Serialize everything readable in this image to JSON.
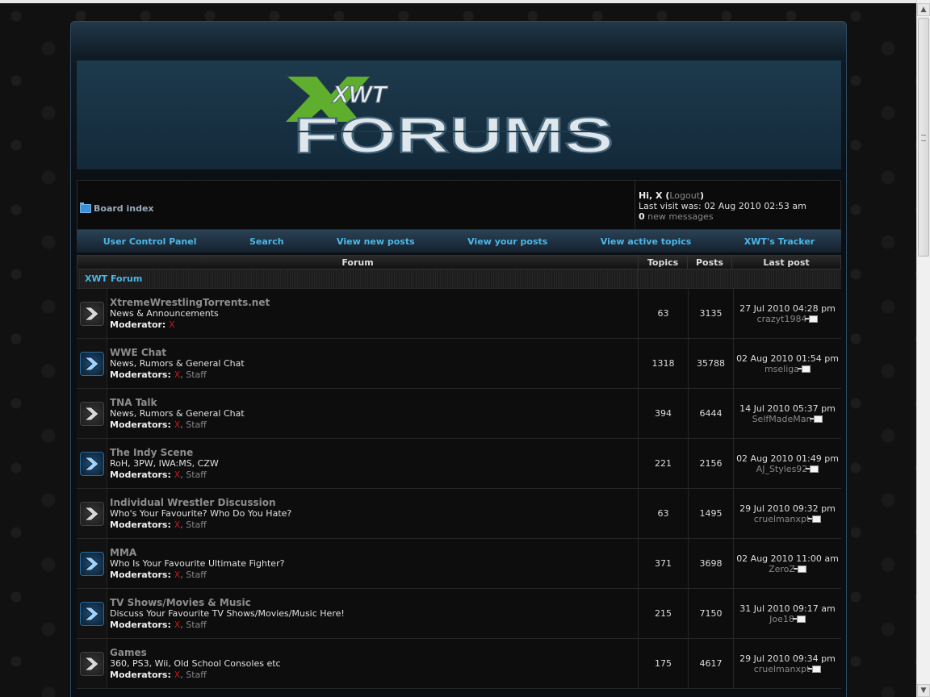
{
  "navbar": {
    "board_index": "Board index",
    "greeting_prefix": "Hi, ",
    "username": "X",
    "logout": "Logout",
    "last_visit": "Last visit was: 02 Aug 2010 02:53 am",
    "new_count": "0",
    "new_messages": " new messages"
  },
  "menu": [
    {
      "label": "User Control Panel"
    },
    {
      "label": "Search"
    },
    {
      "label": "View new posts"
    },
    {
      "label": "View your posts"
    },
    {
      "label": "View active topics"
    },
    {
      "label": "XWT's Tracker"
    }
  ],
  "table": {
    "col_forum": "Forum",
    "col_topics": "Topics",
    "col_posts": "Posts",
    "col_last": "Last post",
    "category": "XWT Forum"
  },
  "forums": [
    {
      "title": "XtremeWrestlingTorrents.net",
      "desc": "News & Announcements",
      "mods_label": "Moderator:",
      "mods": [
        "X"
      ],
      "topics": "63",
      "posts": "3135",
      "last_date": "27 Jul 2010 04:28 pm",
      "last_user": "crazyt1984",
      "icon": "grey"
    },
    {
      "title": "WWE Chat",
      "desc": "News, Rumors & General Chat",
      "mods_label": "Moderators:",
      "mods": [
        "X",
        "Staff"
      ],
      "topics": "1318",
      "posts": "35788",
      "last_date": "02 Aug 2010 01:54 pm",
      "last_user": "mseliga",
      "icon": "blue"
    },
    {
      "title": "TNA Talk",
      "desc": "News, Rumors & General Chat",
      "mods_label": "Moderators:",
      "mods": [
        "X",
        "Staff"
      ],
      "topics": "394",
      "posts": "6444",
      "last_date": "14 Jul 2010 05:37 pm",
      "last_user": "SelfMadeMan",
      "icon": "grey"
    },
    {
      "title": "The Indy Scene",
      "desc": "RoH, 3PW, IWA:MS, CZW",
      "mods_label": "Moderators:",
      "mods": [
        "X",
        "Staff"
      ],
      "topics": "221",
      "posts": "2156",
      "last_date": "02 Aug 2010 01:49 pm",
      "last_user": "AJ_Styles92",
      "icon": "blue"
    },
    {
      "title": "Individual Wrestler Discussion",
      "desc": "Who's Your Favourite? Who Do You Hate?",
      "mods_label": "Moderators:",
      "mods": [
        "X",
        "Staff"
      ],
      "topics": "63",
      "posts": "1495",
      "last_date": "29 Jul 2010 09:32 pm",
      "last_user": "cruelmanxpt",
      "icon": "grey"
    },
    {
      "title": "MMA",
      "desc": "Who Is Your Favourite Ultimate Fighter?",
      "mods_label": "Moderators:",
      "mods": [
        "X",
        "Staff"
      ],
      "topics": "371",
      "posts": "3698",
      "last_date": "02 Aug 2010 11:00 am",
      "last_user": "ZeroZ",
      "icon": "blue"
    },
    {
      "title": "TV Shows/Movies & Music",
      "desc": "Discuss Your Favourite TV Shows/Movies/Music Here!",
      "mods_label": "Moderators:",
      "mods": [
        "X",
        "Staff"
      ],
      "topics": "215",
      "posts": "7150",
      "last_date": "31 Jul 2010 09:17 am",
      "last_user": "Joe18",
      "icon": "blue"
    },
    {
      "title": "Games",
      "desc": "360, PS3, Wii, Old School Consoles etc",
      "mods_label": "Moderators:",
      "mods": [
        "X",
        "Staff"
      ],
      "topics": "175",
      "posts": "4617",
      "last_date": "29 Jul 2010 09:34 pm",
      "last_user": "cruelmanxpt",
      "icon": "grey"
    }
  ],
  "colors": {
    "accent": "#4bb7e8",
    "mod_red": "#c21b1b",
    "logo_green": "#5fae2e"
  }
}
